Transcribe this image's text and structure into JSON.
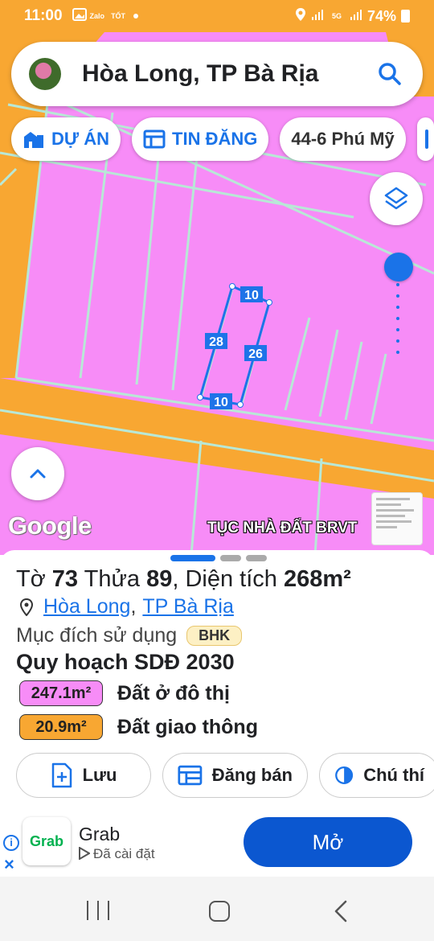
{
  "status_bar": {
    "time": "11:00",
    "app_notif_zalo": "Zalo",
    "app_notif_tot": "TỐT",
    "network": "5G",
    "battery": "74%"
  },
  "search": {
    "query": "Hòa Long, TP Bà Rịa"
  },
  "chips": [
    {
      "label": "DỰ ÁN"
    },
    {
      "label": "TIN ĐĂNG"
    },
    {
      "label": "44-6 Phú Mỹ"
    }
  ],
  "map": {
    "parcel_edges": {
      "top": "10",
      "left": "28",
      "right": "26",
      "bottom": "10"
    },
    "google_logo": "Google",
    "watermark": "TỤC NHÀ ĐẤT BRVT",
    "colors": {
      "residential": "#f78cf7",
      "road": "#f8a732",
      "parcel_line": "#a8dcc8",
      "selection": "#1e73e8"
    }
  },
  "sheet": {
    "sheet_label": "Tờ",
    "sheet_number": "73",
    "plot_label": "Thửa",
    "plot_number": "89",
    "area_label": "Diện tích",
    "area_value": "268m²",
    "ward": "Hòa Long",
    "city": "TP Bà Rịa",
    "separator": ",",
    "purpose_label": "Mục đích sử dụng",
    "purpose_code": "BHK",
    "plan_title": "Quy hoạch SDĐ 2030",
    "land_uses": [
      {
        "area": "247.1m²",
        "label": "Đất ở đô thị",
        "color": "#f78cf7"
      },
      {
        "area": "20.9m²",
        "label": "Đất giao thông",
        "color": "#f8a732"
      }
    ],
    "actions": [
      {
        "label": "Lưu"
      },
      {
        "label": "Đăng bán"
      },
      {
        "label": "Chú thí"
      }
    ]
  },
  "ad": {
    "info": "i",
    "close": "×",
    "logo_text": "Grab",
    "title": "Grab",
    "subtitle": "Đã cài đặt",
    "button": "Mở"
  }
}
